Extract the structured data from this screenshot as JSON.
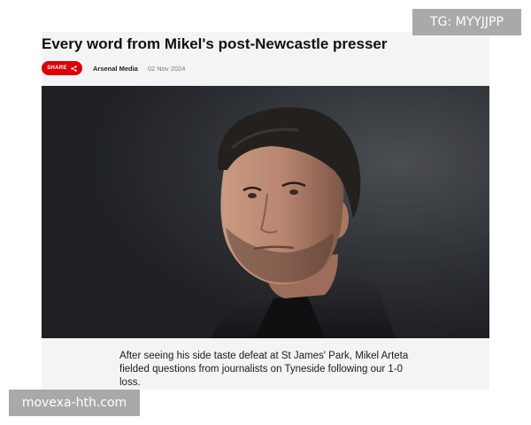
{
  "article": {
    "headline": "Every word from Mikel's post-Newcastle presser",
    "share_label": "SHARE",
    "author": "Arsenal Media",
    "date": "02 Nov 2024",
    "intro": "After seeing his side taste defeat at St James' Park, Mikel Arteta fielded questions from journalists on Tyneside following our 1-0 loss."
  },
  "overlays": {
    "tg_label": "TG: MYYJJPP",
    "site_label": "movexa-hth.com"
  },
  "icons": {
    "share": "share-icon"
  },
  "colors": {
    "accent": "#db0007",
    "badge": "#a9a9a9"
  }
}
